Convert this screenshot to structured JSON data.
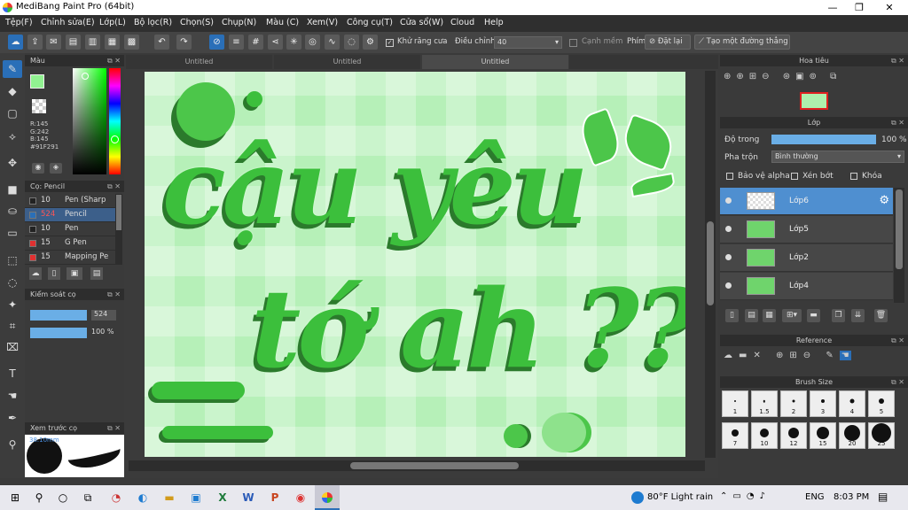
{
  "window": {
    "title": "MediBang Paint Pro (64bit)",
    "minimize": "—",
    "maximize": "❐",
    "close": "✕"
  },
  "menu": [
    "Tệp(F)",
    "Chỉnh sửa(E)",
    "Lớp(L)",
    "Bộ lọc(R)",
    "Chọn(S)",
    "Chụp(N)",
    "Màu (C)",
    "Xem(V)",
    "Công cụ(T)",
    "Cửa sổ(W)",
    "Cloud",
    "Help"
  ],
  "toolbar": {
    "antialias_label": "Khử răng cưa",
    "adjust_label": "Điều chỉnh",
    "adjust_value": "40",
    "edge_label": "Cạnh mềm",
    "key_label": "Phím",
    "reset_label": "Đặt lại",
    "create_line_label": "Tạo một đường thẳng"
  },
  "tabs": [
    "Untitled",
    "Untitled",
    "Untitled"
  ],
  "color_panel": {
    "title": "Màu",
    "r": "R:145",
    "g": "G:242",
    "b": "B:145",
    "hex": "#91F291",
    "fg_color": "#91F291"
  },
  "brush_panel": {
    "title": "Cọ: Pencil",
    "items": [
      {
        "size": "10",
        "name": "Pen (Sharp",
        "color": "#222222"
      },
      {
        "size": "524",
        "name": "Pencil",
        "color": "#2a6fb8"
      },
      {
        "size": "10",
        "name": "Pen",
        "color": "#222222"
      },
      {
        "size": "15",
        "name": "G Pen",
        "color": "#e03030"
      },
      {
        "size": "15",
        "name": "Mapping Pe",
        "color": "#e03030"
      }
    ]
  },
  "brush_control": {
    "title": "Kiểm soát cọ",
    "size": "524",
    "opacity": "100 %"
  },
  "preview_panel": {
    "title": "Xem trước cọ",
    "value": "38.10mm"
  },
  "navigator": {
    "title": "Hoa tiêu"
  },
  "layer_panel": {
    "title": "Lớp",
    "opacity_label": "Độ trong",
    "opacity_value": "100 %",
    "opacity_fraction": 1.0,
    "blend_label": "Pha trộn",
    "blend_value": "Bình thường",
    "protect_alpha": "Bảo vệ alpha",
    "clip": "Xén bớt",
    "lock": "Khóa",
    "layers": [
      {
        "name": "Lớp6",
        "selected": true
      },
      {
        "name": "Lớp5",
        "selected": false
      },
      {
        "name": "Lớp2",
        "selected": false
      },
      {
        "name": "Lớp4",
        "selected": false
      }
    ]
  },
  "reference_panel": {
    "title": "Reference"
  },
  "brush_size_panel": {
    "title": "Brush Size",
    "sizes": [
      "1",
      "1.5",
      "2",
      "3",
      "4",
      "5",
      "7",
      "10",
      "12",
      "15",
      "20",
      "25"
    ]
  },
  "canvas_text": {
    "line1": "cậu yêu",
    "line2": "tớ ah ??"
  },
  "taskbar": {
    "weather": "80°F  Light rain",
    "lang": "ENG",
    "time": "8:03 PM"
  }
}
